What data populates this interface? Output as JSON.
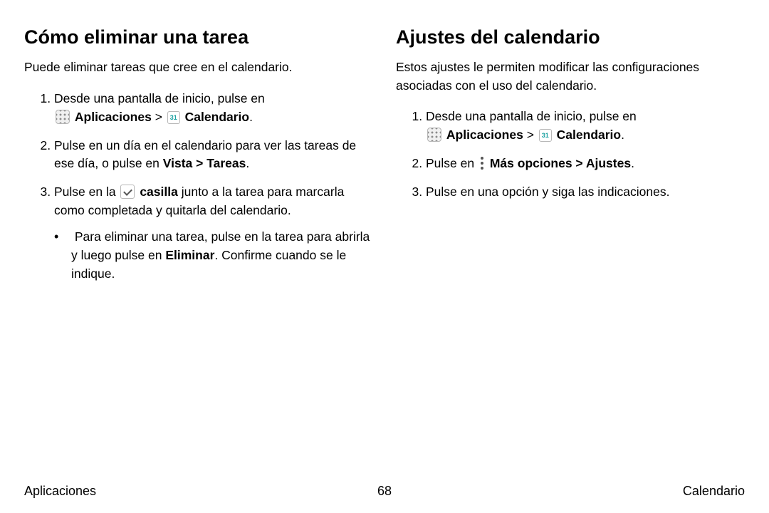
{
  "left": {
    "heading": "Cómo eliminar una tarea",
    "intro": "Puede eliminar tareas que cree en el calendario.",
    "steps": {
      "s1a": "Desde una pantalla de inicio, pulse en",
      "apps_label": "Aplicaciones",
      "arrow1": " > ",
      "cal_label": "Calendario",
      "s2a": "Pulse en un día en el calendario para ver las tareas de ese día, o pulse en ",
      "s2b_bold": "Vista > Tareas",
      "s3a": "Pulse en la ",
      "s3b_bold": "casilla",
      "s3c": " junto a la tarea para marcarla como completada y quitarla del calendario.",
      "s3_sub_a": "Para eliminar una tarea, pulse en la tarea para abrirla y luego pulse en ",
      "s3_sub_bold": "Eliminar",
      "s3_sub_c": ". Confirme cuando se le indique."
    }
  },
  "right": {
    "heading": "Ajustes del calendario",
    "intro": "Estos ajustes le permiten modificar las configuraciones asociadas con el uso del calendario.",
    "steps": {
      "s1a": "Desde una pantalla de inicio, pulse en",
      "apps_label": "Aplicaciones",
      "arrow1": " > ",
      "cal_label": "Calendario",
      "s2a": "Pulse en ",
      "s2b_bold": "Más opciones > Ajustes",
      "s3": "Pulse en una opción y siga las indicaciones."
    }
  },
  "footer": {
    "left": "Aplicaciones",
    "center": "68",
    "right": "Calendario"
  }
}
